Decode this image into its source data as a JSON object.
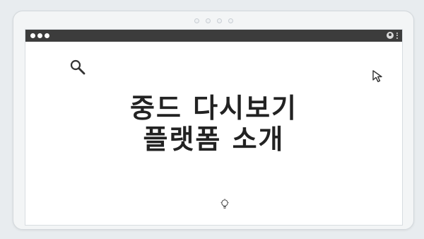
{
  "window": {
    "title_controls": [
      "close",
      "minimize",
      "maximize"
    ]
  },
  "icons": {
    "search": "search-icon",
    "cursor": "cursor-arrow-icon",
    "lightbulb": "lightbulb-icon",
    "profile": "profile-icon",
    "menu": "kebab-menu-icon"
  },
  "content": {
    "headline_line1": "중드 다시보기",
    "headline_line2": "플랫폼 소개"
  },
  "colors": {
    "titlebar": "#3c3c3c",
    "background": "#e8ecef",
    "content_bg": "#ffffff",
    "text": "#222222"
  }
}
